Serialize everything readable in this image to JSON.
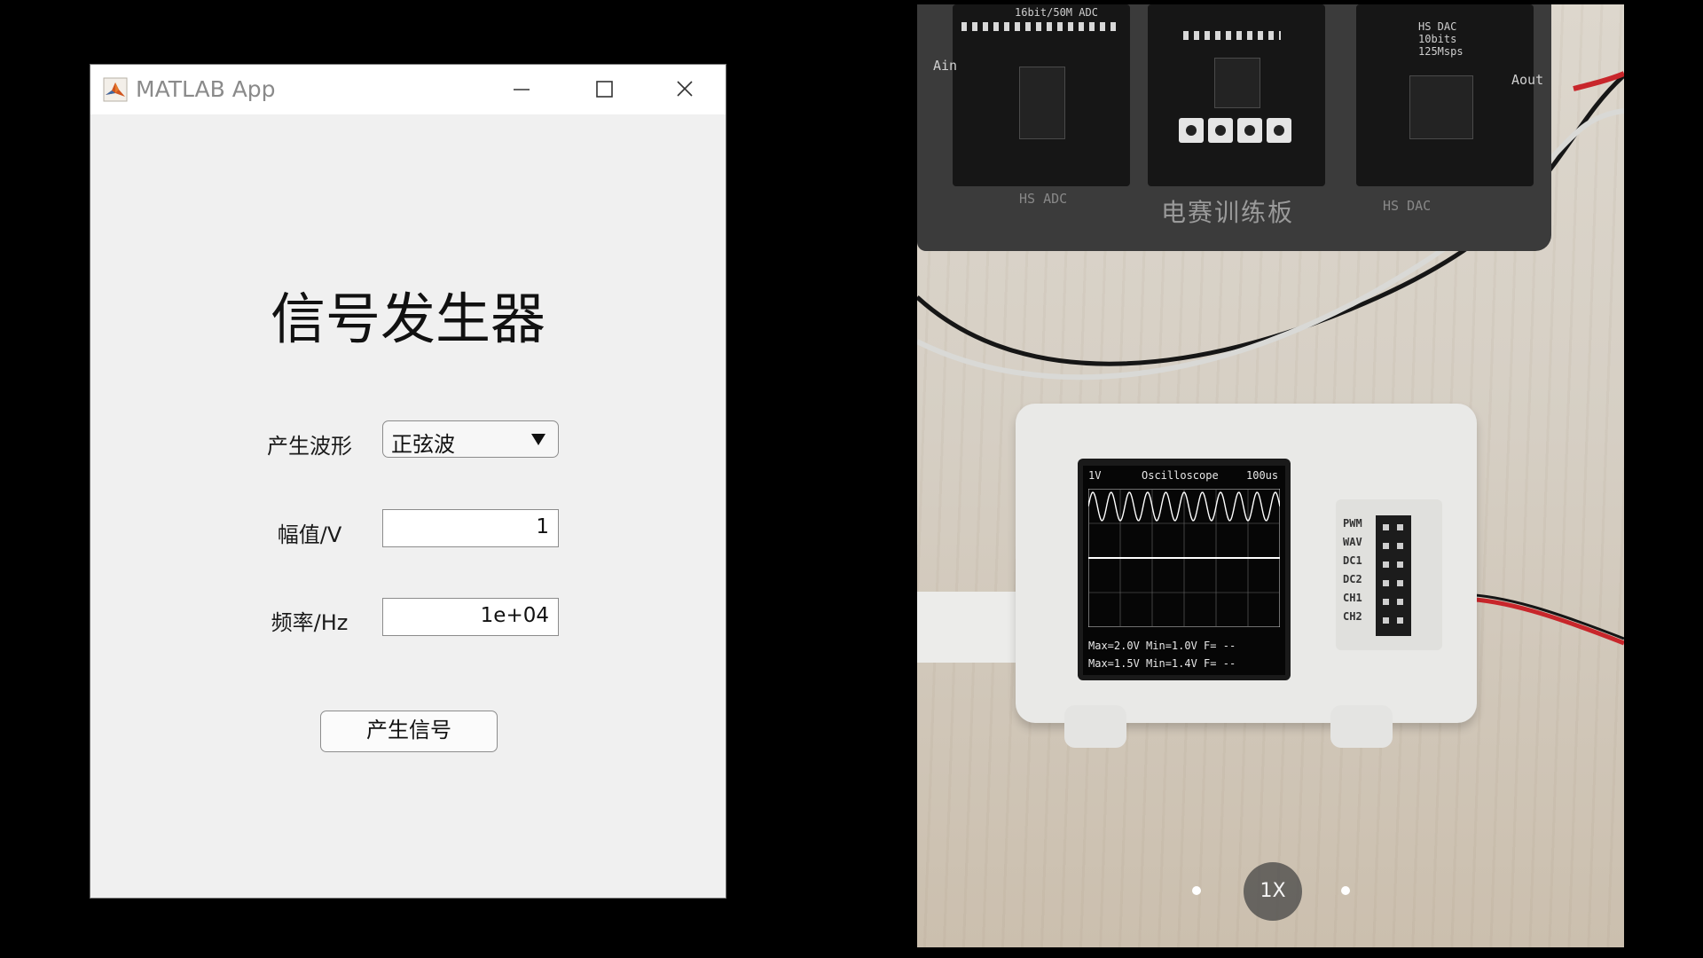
{
  "window": {
    "title": "MATLAB App",
    "heading": "信号发生器",
    "controls": [
      "minimize",
      "maximize",
      "close"
    ]
  },
  "form": {
    "waveform_label": "产生波形",
    "waveform_value": "正弦波",
    "amplitude_label": "幅值/V",
    "amplitude_value": "1",
    "frequency_label": "频率/Hz",
    "frequency_value": "1e+04",
    "generate_button": "产生信号"
  },
  "camera": {
    "zoom_label": "1X",
    "board": {
      "title": "电赛训练板",
      "adc_top": "16bit/50M ADC",
      "dac_top": "HS DAC\n10bits\n125Msps",
      "adc_bottom": "HS ADC",
      "dac_bottom": "HS DAC",
      "ain": "Ain",
      "aout": "Aout"
    },
    "oscilloscope": {
      "volts_div": "1V",
      "title": "Oscilloscope",
      "time_div": "100us",
      "ch1_stats": "Max=2.0V  Min=1.0V  F=  --",
      "ch2_stats": "Max=1.5V  Min=1.4V  F=  --",
      "ports": [
        "PWM",
        "WAV",
        "DC1",
        "DC2",
        "CH1",
        "CH2"
      ]
    }
  },
  "colors": {
    "window_bg": "#f0f0f0",
    "titlebar_bg": "#ffffff",
    "trace": "#ffffff",
    "wire_red": "#c8262b"
  }
}
